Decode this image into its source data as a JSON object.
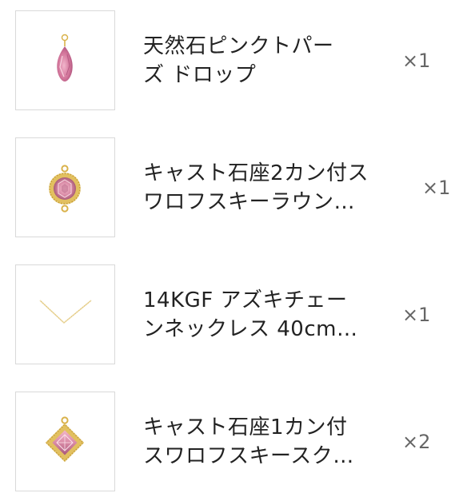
{
  "cart": {
    "items": [
      {
        "name_line1": "天然石ピンクトパー",
        "name_line2": "ズ ドロップ",
        "quantity": "×1",
        "thumbnail_icon": "pink-topaz-drop-icon"
      },
      {
        "name_line1": "キャスト石座2カン付ス",
        "name_line2": "ワロフスキーラウン…",
        "quantity": "×1",
        "thumbnail_icon": "round-crystal-connector-icon"
      },
      {
        "name_line1": "14KGF アズキチェー",
        "name_line2": "ンネックレス 40cm…",
        "quantity": "×1",
        "thumbnail_icon": "gold-chain-necklace-icon"
      },
      {
        "name_line1": "キャスト石座1カン付",
        "name_line2": "スワロフスキースク…",
        "quantity": "×2",
        "thumbnail_icon": "square-crystal-charm-icon"
      }
    ]
  },
  "colors": {
    "gold": "#d9b24a",
    "pink_stone": "#d98aa6",
    "border": "#d9d9d9",
    "quantity_text": "#666666"
  }
}
